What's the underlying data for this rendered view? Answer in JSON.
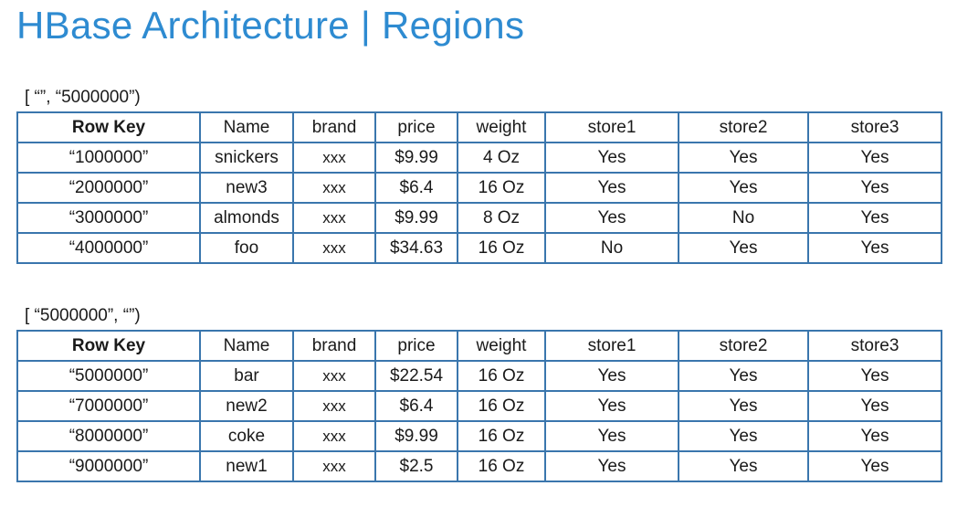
{
  "title": "HBase Architecture | Regions",
  "columns": [
    "Row Key",
    "Name",
    "brand",
    "price",
    "weight",
    "store1",
    "store2",
    "store3"
  ],
  "regions": [
    {
      "range": "[ “”, “5000000”)",
      "rows": [
        [
          "“1000000”",
          "snickers",
          "xxx",
          "$9.99",
          "4 Oz",
          "Yes",
          "Yes",
          "Yes"
        ],
        [
          "“2000000”",
          "new3",
          "xxx",
          "$6.4",
          "16 Oz",
          "Yes",
          "Yes",
          "Yes"
        ],
        [
          "“3000000”",
          "almonds",
          "xxx",
          "$9.99",
          "8 Oz",
          "Yes",
          "No",
          "Yes"
        ],
        [
          "“4000000”",
          "foo",
          "xxx",
          "$34.63",
          "16 Oz",
          "No",
          "Yes",
          "Yes"
        ]
      ]
    },
    {
      "range": "[ “5000000”, “”)",
      "rows": [
        [
          "“5000000”",
          "bar",
          "xxx",
          "$22.54",
          "16 Oz",
          "Yes",
          "Yes",
          "Yes"
        ],
        [
          "“7000000”",
          "new2",
          "xxx",
          "$6.4",
          "16 Oz",
          "Yes",
          "Yes",
          "Yes"
        ],
        [
          "“8000000”",
          "coke",
          "xxx",
          "$9.99",
          "16 Oz",
          "Yes",
          "Yes",
          "Yes"
        ],
        [
          "“9000000”",
          "new1",
          "xxx",
          "$2.5",
          "16 Oz",
          "Yes",
          "Yes",
          "Yes"
        ]
      ]
    }
  ],
  "colors": {
    "title": "#2e8bd1",
    "table_border": "#3a76ad"
  }
}
